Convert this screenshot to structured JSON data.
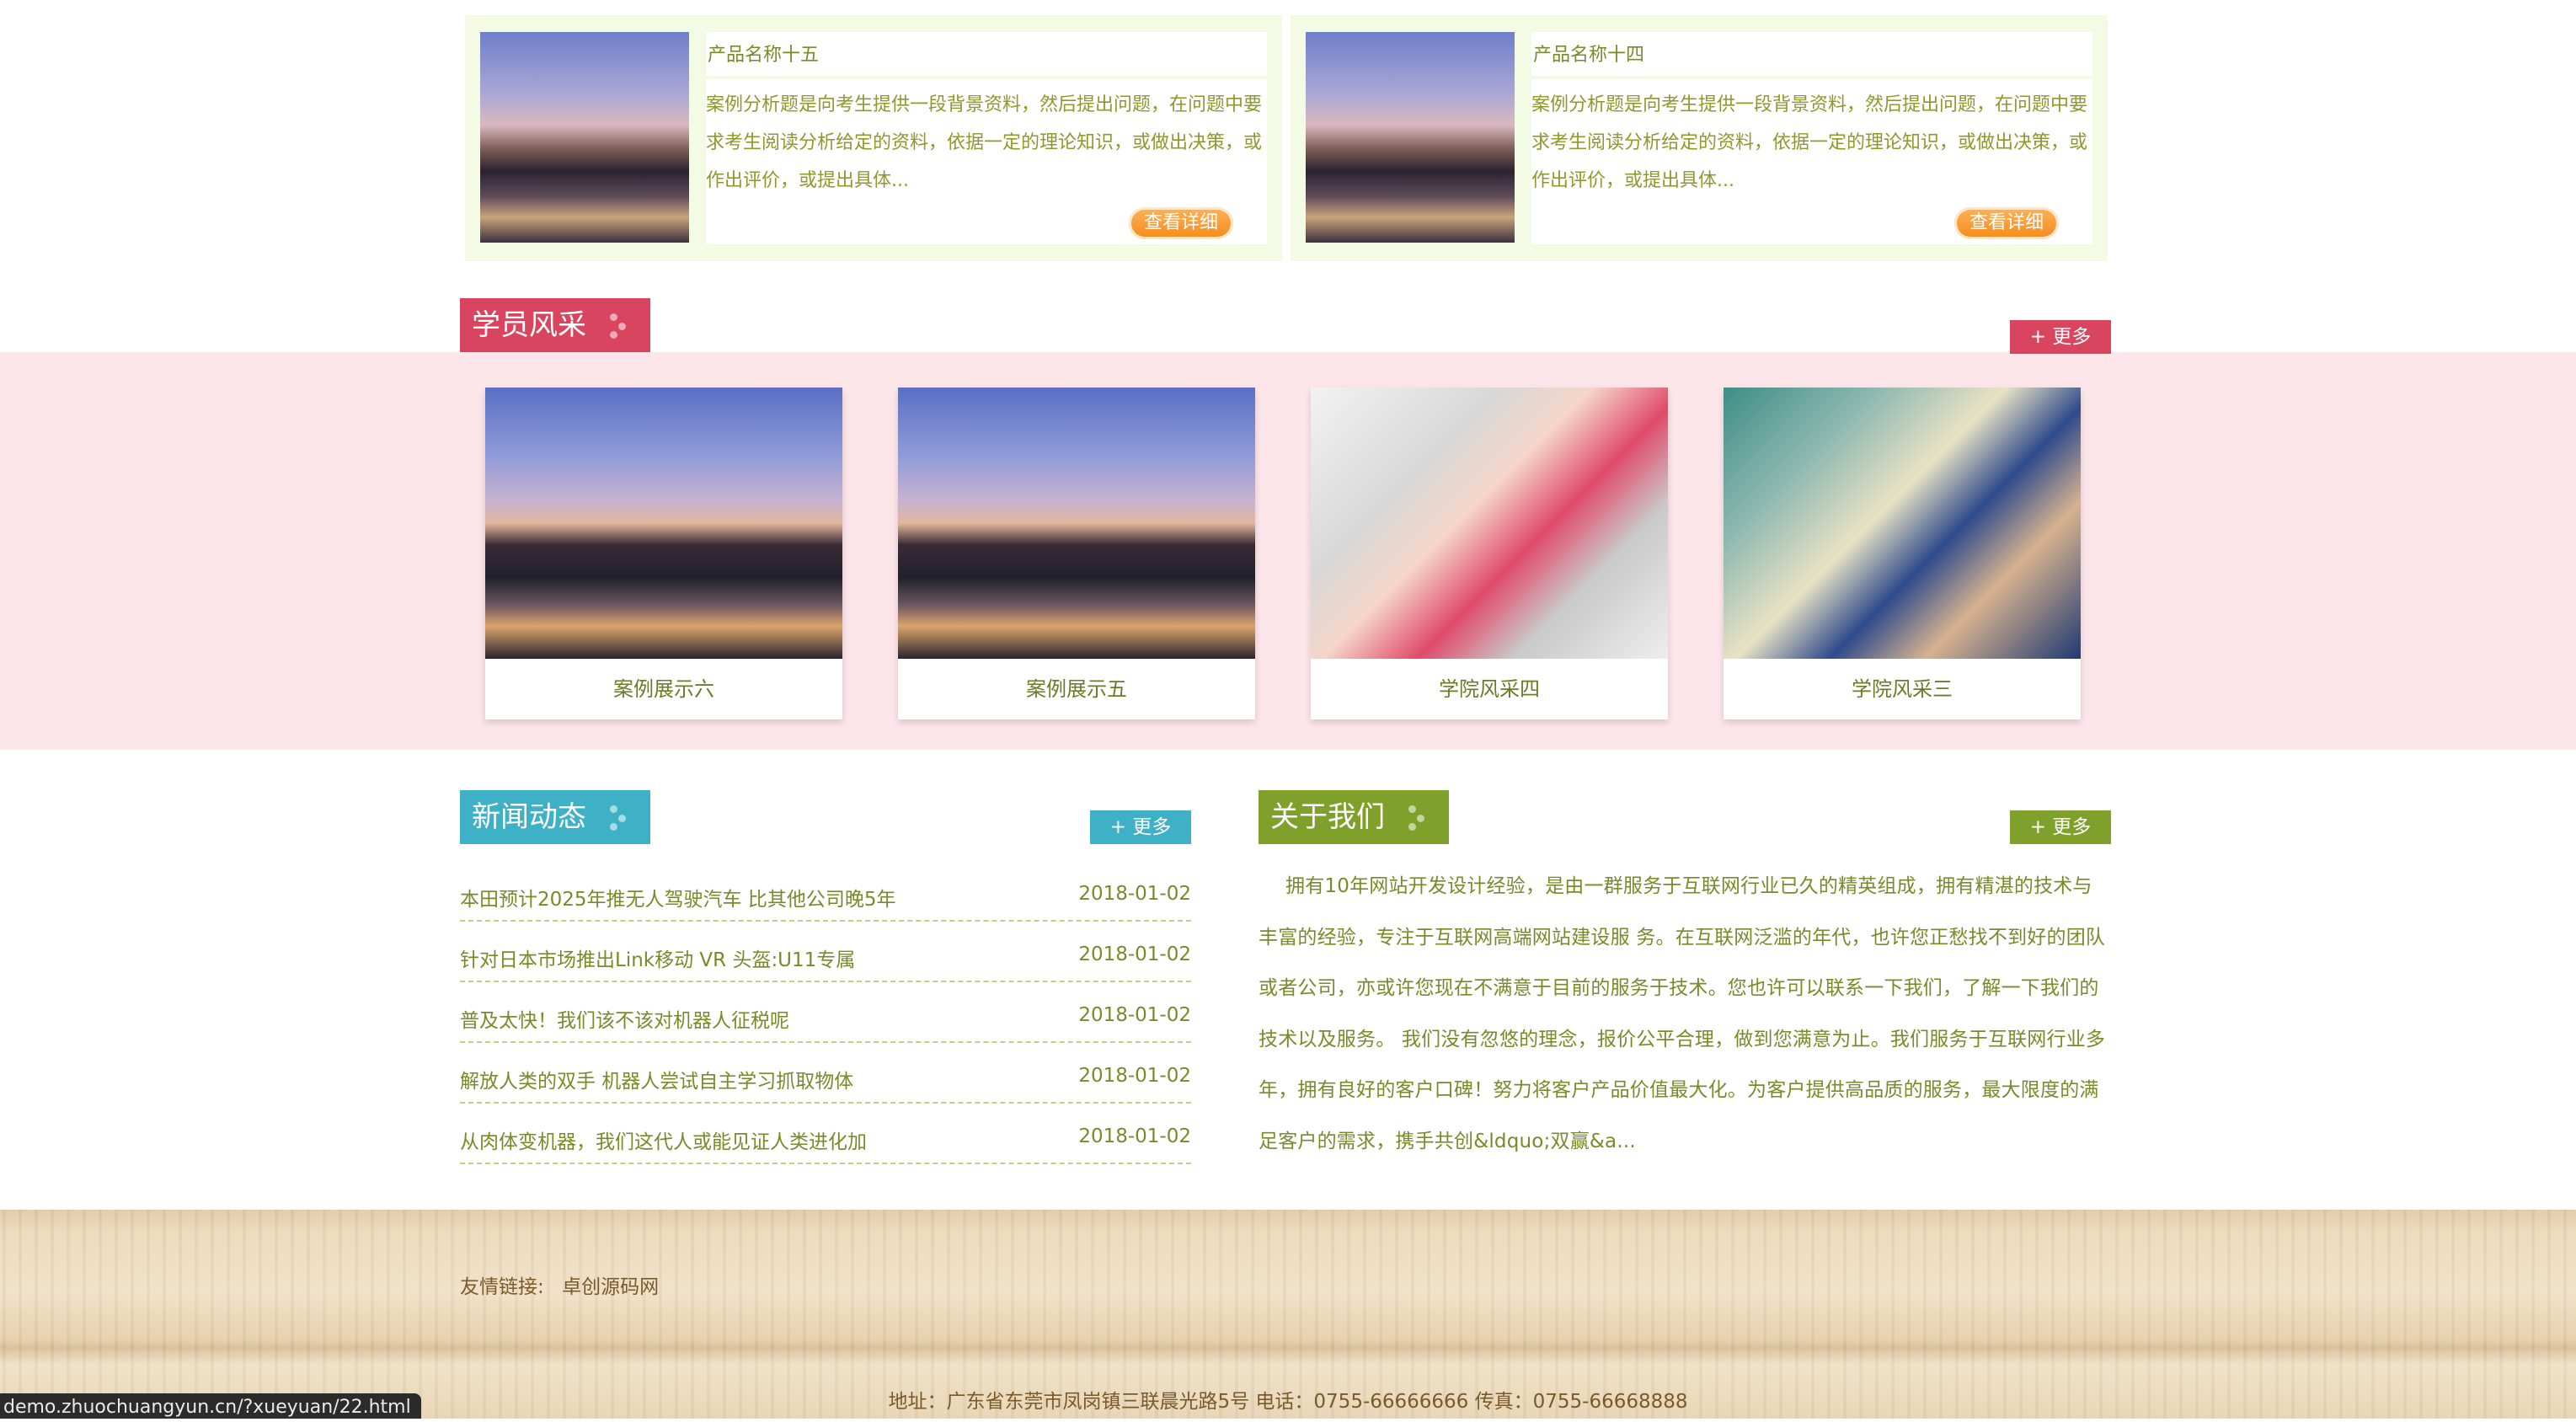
{
  "products": [
    {
      "name": "产品名称十五",
      "desc": "案例分析题是向考生提供一段背景资料，然后提出问题，在问题中要求考生阅读分析给定的资料，依据一定的理论知识，或做出决策，或作出评价，或提出具体...",
      "button": "查看详细"
    },
    {
      "name": "产品名称十四",
      "desc": "案例分析题是向考生提供一段背景资料，然后提出问题，在问题中要求考生阅读分析给定的资料，依据一定的理论知识，或做出决策，或作出评价，或提出具体...",
      "button": "查看详细"
    }
  ],
  "students": {
    "title": "学员风采",
    "more": "+ 更多",
    "items": [
      {
        "caption": "案例展示六"
      },
      {
        "caption": "案例展示五"
      },
      {
        "caption": "学院风采四"
      },
      {
        "caption": "学院风采三"
      }
    ]
  },
  "news": {
    "title": "新闻动态",
    "more": "+ 更多",
    "items": [
      {
        "title": "本田预计2025年推无人驾驶汽车 比其他公司晚5年",
        "date": "2018-01-02"
      },
      {
        "title": "针对日本市场推出Link移动 VR 头盔:U11专属",
        "date": "2018-01-02"
      },
      {
        "title": "普及太快！我们该不该对机器人征税呢",
        "date": "2018-01-02"
      },
      {
        "title": "解放人类的双手 机器人尝试自主学习抓取物体",
        "date": "2018-01-02"
      },
      {
        "title": "从肉体变机器，我们这代人或能见证人类进化加",
        "date": "2018-01-02"
      }
    ]
  },
  "about": {
    "title": "关于我们",
    "more": "+ 更多",
    "text": "拥有10年网站开发设计经验，是由一群服务于互联网行业已久的精英组成，拥有精湛的技术与丰富的经验，专注于互联网高端网站建设服 务。在互联网泛滥的年代，也许您正愁找不到好的团队或者公司，亦或许您现在不满意于目前的服务于技术。您也许可以联系一下我们，了解一下我们的技术以及服务。    我们没有忽悠的理念，报价公平合理，做到您满意为止。我们服务于互联网行业多年，拥有良好的客户口碑！努力将客户产品价值最大化。为客户提供高品质的服务，最大限度的满足客户的需求，携手共创&ldquo;双赢&a..."
  },
  "footer": {
    "links_label": "友情链接:",
    "links": [
      "卓创源码网"
    ],
    "info": "地址：广东省东莞市凤岗镇三联晨光路5号   电话：0755-66666666   传真：0755-66668888"
  },
  "status_url": "demo.zhuochuangyun.cn/?xueyuan/22.html",
  "colors": {
    "students_accent": "#d9445f",
    "news_accent": "#3fb1c6",
    "about_accent": "#7fa02a",
    "button_orange": "#f59a2c",
    "gallery_band": "#fde6ea",
    "product_bg": "#f3fbe4"
  }
}
